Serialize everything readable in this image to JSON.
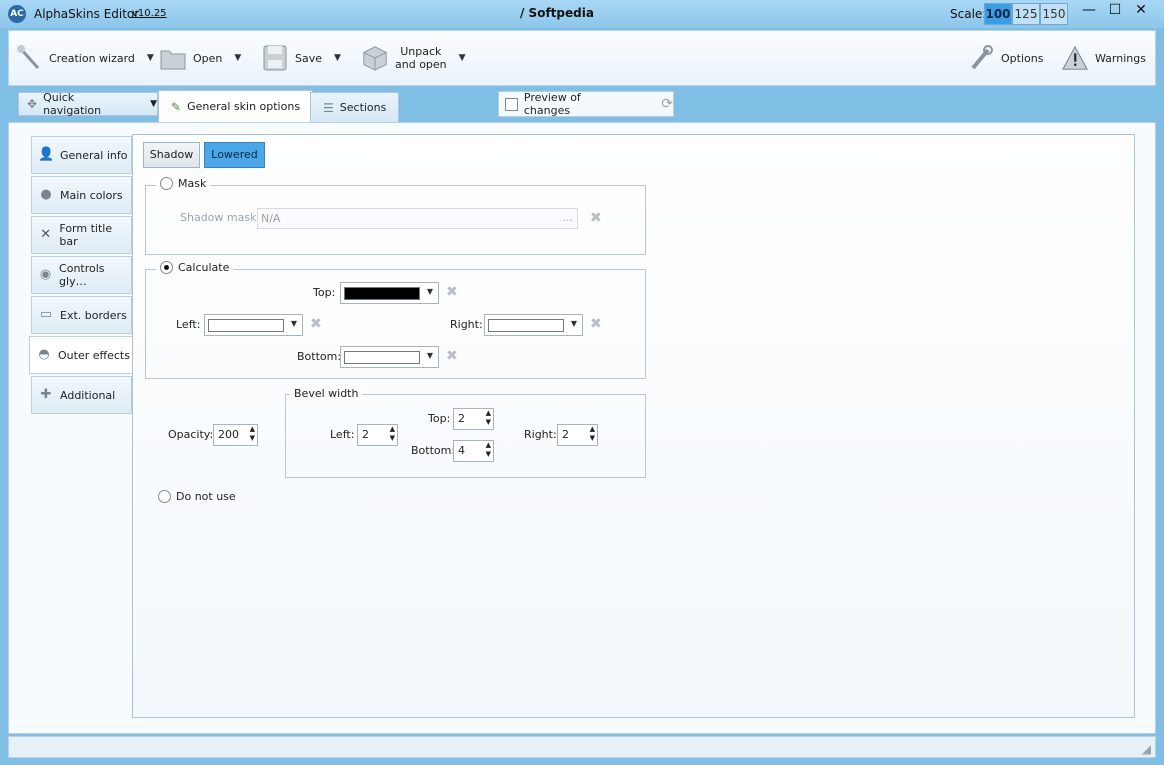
{
  "titlebar": {
    "app_title": "AlphaSkins Editor",
    "version": "v10.25",
    "document": "/ Softpedia",
    "scale_label": "Scale:",
    "scale_options": [
      "100",
      "125",
      "150"
    ],
    "scale_selected": "100",
    "controls": {
      "minimize": "—",
      "maximize": "☐",
      "close": "✕"
    }
  },
  "toolbar": {
    "creation_wizard": "Creation wizard",
    "open": "Open",
    "save": "Save",
    "unpack_line1": "Unpack",
    "unpack_line2": "and open",
    "options": "Options",
    "warnings": "Warnings"
  },
  "tabs": {
    "quick_navigation": "Quick navigation",
    "general_skin_options": "General  skin options",
    "sections": "Sections",
    "preview_of_changes": "Preview of changes"
  },
  "sidebar": {
    "items": [
      {
        "label": "General info",
        "icon": "user-icon"
      },
      {
        "label": "Main colors",
        "icon": "palette-icon"
      },
      {
        "label": "Form title bar",
        "icon": "x-icon"
      },
      {
        "label": "Controls gly…",
        "icon": "radio-icon"
      },
      {
        "label": "Ext. borders",
        "icon": "window-icon"
      },
      {
        "label": "Outer effects",
        "icon": "shadow-icon"
      },
      {
        "label": "Additional",
        "icon": "plus-icon"
      }
    ],
    "active": "Outer effects"
  },
  "effects": {
    "shadow_btn": "Shadow",
    "lowered_btn": "Lowered",
    "mask": {
      "label": "Mask",
      "shadow_mask_label": "Shadow mask:",
      "shadow_mask_value": "N/A",
      "browse": "..."
    },
    "calculate": {
      "label": "Calculate",
      "top": "Top:",
      "left": "Left:",
      "right": "Right:",
      "bottom": "Bottom:",
      "top_color": "#000000",
      "left_color": "#ffffff",
      "right_color": "#ffffff",
      "bottom_color": "#ffffff"
    },
    "opacity_label": "Opacity:",
    "opacity_value": "200",
    "bevel": {
      "title": "Bevel width",
      "left_label": "Left:",
      "left_value": "2",
      "top_label": "Top:",
      "top_value": "2",
      "bottom_label": "Bottom:",
      "bottom_value": "4",
      "right_label": "Right:",
      "right_value": "2"
    },
    "do_not_use": "Do not use"
  },
  "colors": {
    "titlebar": "#8cc6ea",
    "accent": "#3a9ee6",
    "lowered_active": "#4aa8e8"
  }
}
